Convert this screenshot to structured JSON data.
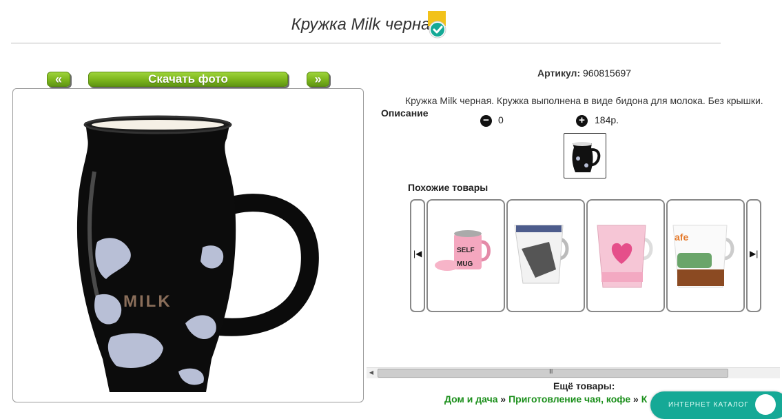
{
  "product": {
    "title": "Кружка Milk черная",
    "article_label": "Артикул:",
    "article_value": "960815697",
    "description_text": "Кружка Milk черная. Кружка выполнена в виде бидона для молока. Без крышки.",
    "description_label": "Описание",
    "quantity": "0",
    "price": "184р."
  },
  "photo_nav": {
    "prev_label": "«",
    "download_label": "Скачать фото",
    "next_label": "»"
  },
  "similar": {
    "label": "Похожие товары",
    "prev_icon": "carousel-prev-icon",
    "next_icon": "carousel-next-icon"
  },
  "footer": {
    "more_label": "Ещё товары:",
    "breadcrumb": [
      "Дом и дача",
      "Приготовление чая, кофе",
      "К"
    ],
    "separator": "»",
    "catalog_button": "ИНТЕРНЕТ КАТАЛОГ"
  },
  "scrollbar": {
    "grip": "III"
  },
  "colors": {
    "accent_green": "#7cb51c",
    "link_green": "#1b8f1b",
    "teal": "#15a996"
  }
}
